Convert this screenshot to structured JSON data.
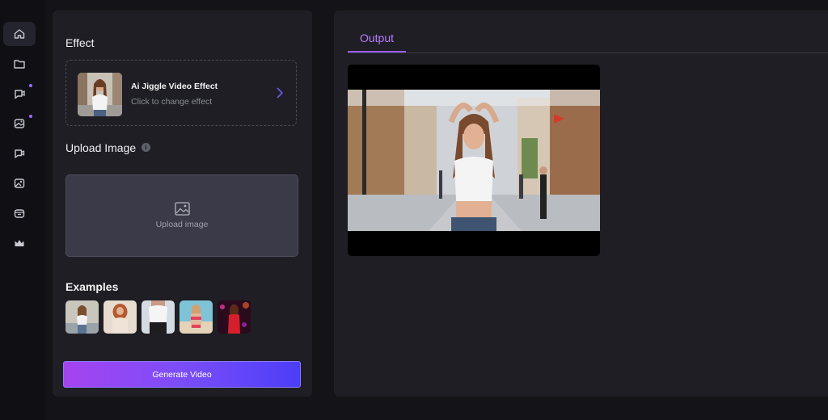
{
  "nav": {
    "items": [
      {
        "icon": "home-icon",
        "active": true
      },
      {
        "icon": "folder-icon",
        "active": false
      },
      {
        "icon": "video-chat-icon",
        "active": false,
        "badge": true
      },
      {
        "icon": "image-edit-icon",
        "active": false,
        "badge": true
      },
      {
        "icon": "chat-video-icon",
        "active": false
      },
      {
        "icon": "gallery-icon",
        "active": false
      },
      {
        "icon": "basket-icon",
        "active": false
      },
      {
        "icon": "crown-icon",
        "active": false
      }
    ],
    "accent": "#9a6bff"
  },
  "effect": {
    "heading": "Effect",
    "name": "Ai Jiggle Video Effect",
    "subtitle": "Click to change effect"
  },
  "upload": {
    "heading": "Upload Image",
    "placeholder": "Upload image"
  },
  "examples": {
    "heading": "Examples",
    "count": 5
  },
  "generate_button": "Generate Video",
  "output": {
    "tab": "Output"
  },
  "colors": {
    "accent_purple": "#9b5cff",
    "button_gradient_start": "#a544f0",
    "button_gradient_end": "#4c3ef7",
    "panel": "#1e1e24",
    "background": "#131318"
  }
}
